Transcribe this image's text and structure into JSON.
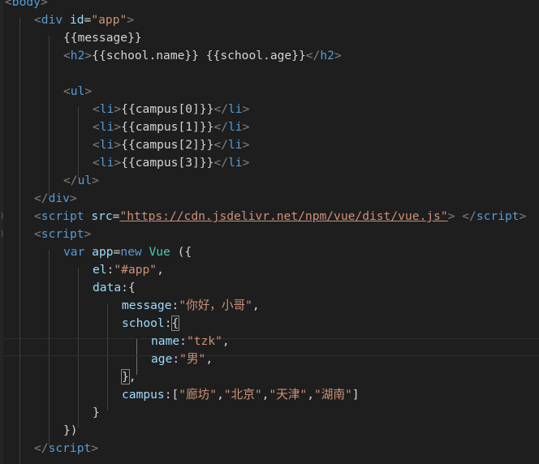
{
  "editor": {
    "tokens": {
      "body": "body",
      "div": "div",
      "id_attr": "id",
      "app_id": "\"app\"",
      "message_expr": "{{message}}",
      "h2": "h2",
      "h2_content": "{{school.name}} {{school.age}}",
      "ul": "ul",
      "li": "li",
      "campus_0": "{{campus[0]}}",
      "campus_1": "{{campus[1]}}",
      "campus_2": "{{campus[2]}}",
      "campus_3": "{{campus[3]}}",
      "script": "script",
      "src_attr": "src",
      "src_url": "\"https://cdn.jsdelivr.net/npm/vue/dist/vue.js\"",
      "var_kw": "var",
      "app_var": "app",
      "new_kw": "new",
      "vue_cls": "Vue",
      "el_key": "el",
      "el_val": "\"#app\"",
      "data_key": "data",
      "message_key": "message",
      "message_val": "\"你好，小哥\"",
      "school_key": "school",
      "name_key": "name",
      "name_val": "\"tzk\"",
      "age_key": "age",
      "age_val": "\"男\"",
      "campus_key": "campus",
      "campus_v0": "\"廊坊\"",
      "campus_v1": "\"北京\"",
      "campus_v2": "\"天津\"",
      "campus_v3": "\"湖南\""
    },
    "colors": {
      "background": "#1e1e1e",
      "tag": "#569cd6",
      "attribute": "#9cdcfe",
      "string": "#ce9178",
      "punctuation": "#808080",
      "class": "#4ec9b0",
      "text": "#d4d4d4"
    }
  }
}
